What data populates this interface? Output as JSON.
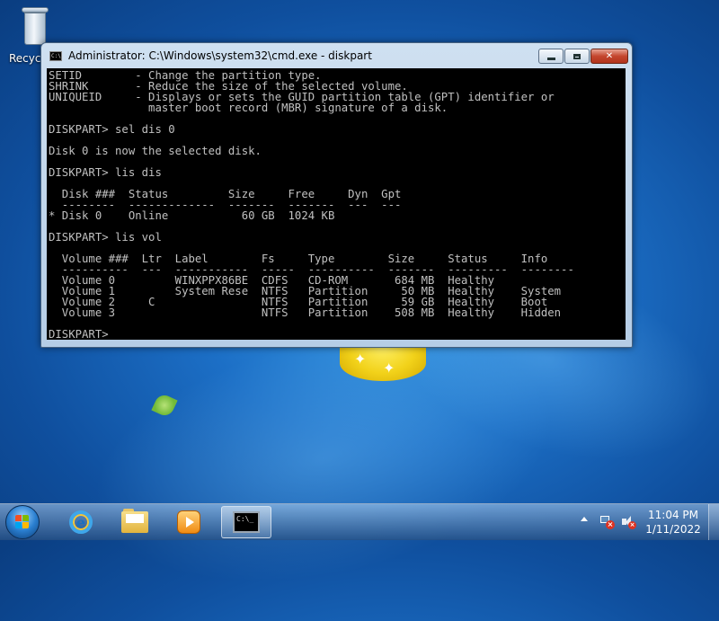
{
  "desktop": {
    "icons": [
      {
        "label": "Recycle Bin",
        "icon": "recycle-bin-icon"
      }
    ]
  },
  "window": {
    "title": "Administrator: C:\\Windows\\system32\\cmd.exe - diskpart",
    "icon": "cmd-icon",
    "buttons": {
      "minimize": "minimize-icon",
      "maximize": "maximize-icon",
      "close": "✕"
    }
  },
  "console": {
    "lines": [
      "SETID        - Change the partition type.",
      "SHRINK       - Reduce the size of the selected volume.",
      "UNIQUEID     - Displays or sets the GUID partition table (GPT) identifier or",
      "               master boot record (MBR) signature of a disk.",
      "",
      "DISKPART> sel dis 0",
      "",
      "Disk 0 is now the selected disk.",
      "",
      "DISKPART> lis dis",
      "",
      "  Disk ###  Status         Size     Free     Dyn  Gpt",
      "  --------  -------------  -------  -------  ---  ---",
      "* Disk 0    Online           60 GB  1024 KB",
      "",
      "DISKPART> lis vol",
      "",
      "  Volume ###  Ltr  Label        Fs     Type        Size     Status     Info",
      "  ----------  ---  -----------  -----  ----------  -------  ---------  --------",
      "  Volume 0         WINXPPX86BE  CDFS   CD-ROM       684 MB  Healthy",
      "  Volume 1         System Rese  NTFS   Partition     50 MB  Healthy    System",
      "  Volume 2     C                NTFS   Partition     59 GB  Healthy    Boot",
      "  Volume 3                      NTFS   Partition    508 MB  Healthy    Hidden",
      "",
      "DISKPART> "
    ]
  },
  "taskbar": {
    "start": "start-orb-icon",
    "pinned": [
      {
        "name": "internet-explorer",
        "icon": "ie-icon",
        "glyph": "e"
      },
      {
        "name": "windows-explorer",
        "icon": "folder-icon"
      },
      {
        "name": "windows-media-player",
        "icon": "media-player-icon"
      },
      {
        "name": "command-prompt",
        "icon": "cmd-icon",
        "active": true,
        "glyph": "C:\\_"
      }
    ],
    "tray": {
      "time": "11:04 PM",
      "date": "1/11/2022",
      "icons": [
        "show-hidden-icons-icon",
        "network-disconnected-icon",
        "volume-muted-icon"
      ]
    }
  },
  "colors": {
    "console_bg": "#000000",
    "console_fg": "#c0c0c0",
    "desktop_blue": "#1c6fc6",
    "close_red": "#c4462e"
  }
}
